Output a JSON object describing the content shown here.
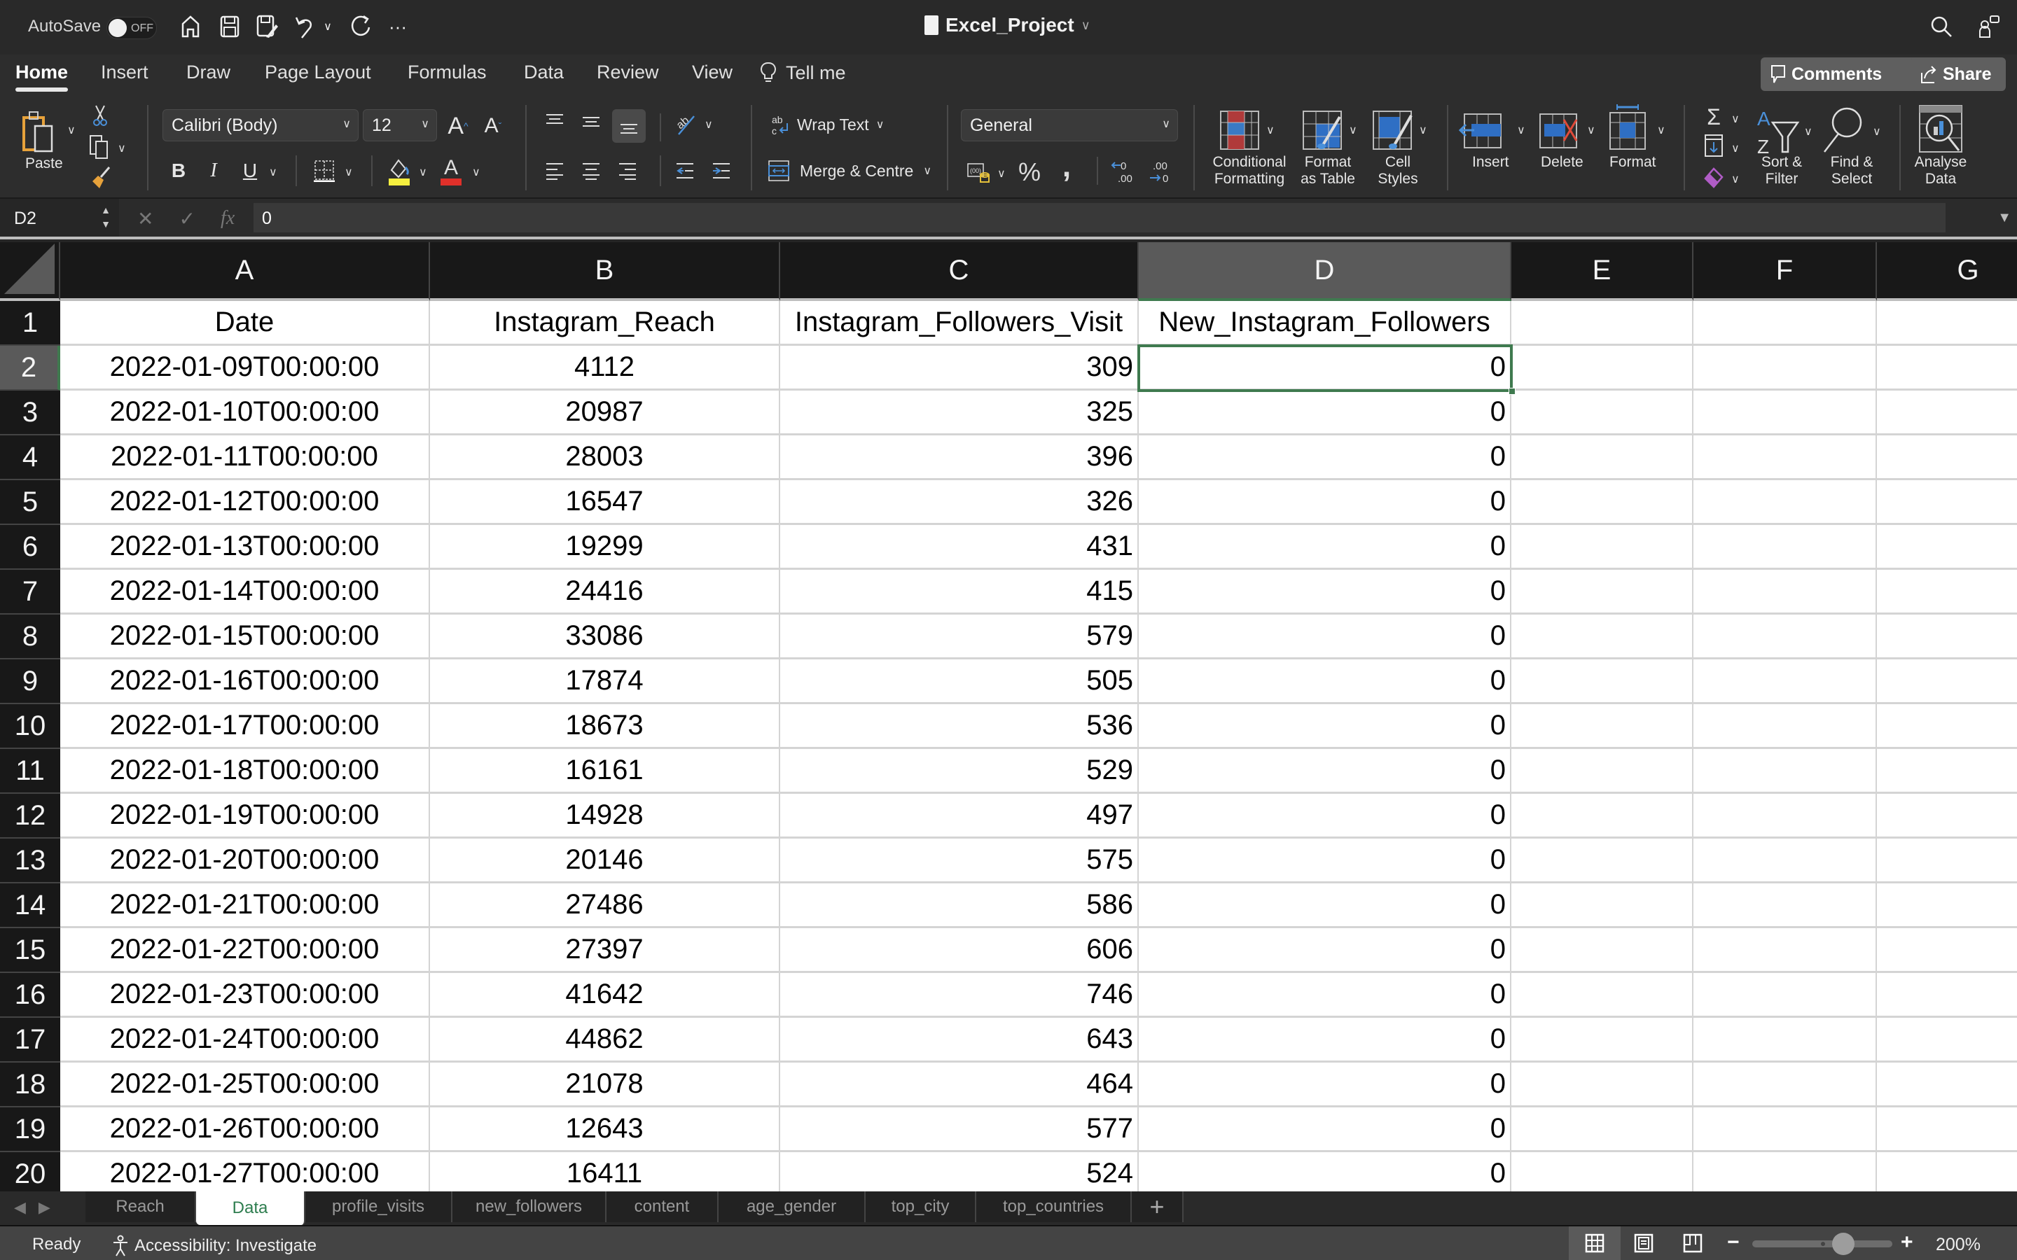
{
  "titlebar": {
    "autosave_label": "AutoSave",
    "autosave_state": "OFF",
    "document_title": "Excel_Project",
    "quick_access": [
      "home-icon",
      "save-icon",
      "save-as-icon",
      "undo-icon",
      "redo-icon",
      "more-icon"
    ]
  },
  "ribbon_tabs": [
    {
      "label": "Home",
      "active": true
    },
    {
      "label": "Insert"
    },
    {
      "label": "Draw"
    },
    {
      "label": "Page Layout"
    },
    {
      "label": "Formulas"
    },
    {
      "label": "Data"
    },
    {
      "label": "Review"
    },
    {
      "label": "View"
    }
  ],
  "tell_me": "Tell me",
  "top_buttons": {
    "comments": "Comments",
    "share": "Share"
  },
  "ribbon": {
    "paste": "Paste",
    "font_name": "Calibri (Body)",
    "font_size": "12",
    "bold": "B",
    "italic": "I",
    "underline": "U",
    "wrap_text": "Wrap Text",
    "merge_centre": "Merge & Centre",
    "number_format": "General",
    "percent": "%",
    "comma": ",",
    "conditional_formatting": [
      "Conditional",
      "Formatting"
    ],
    "format_as_table": [
      "Format",
      "as Table"
    ],
    "cell_styles": [
      "Cell",
      "Styles"
    ],
    "insert": "Insert",
    "delete": "Delete",
    "format": "Format",
    "sort_filter": [
      "Sort &",
      "Filter"
    ],
    "find_select": [
      "Find &",
      "Select"
    ],
    "analyse_data": [
      "Analyse",
      "Data"
    ],
    "colors": {
      "fill": "#f5ef3f",
      "font": "#e0302a",
      "accent_blue": "#4a90d9",
      "accent_red": "#c0392b"
    }
  },
  "formula_bar": {
    "name_box": "D2",
    "formula": "0"
  },
  "sheet": {
    "columns": [
      "A",
      "B",
      "C",
      "D",
      "E",
      "F",
      "G"
    ],
    "selected_column": "D",
    "selected_row": 2,
    "selected_cell": "D2",
    "header_row": [
      "Date",
      "Instagram_Reach",
      "Instagram_Followers_Visit",
      "New_Instagram_Followers"
    ],
    "rows": [
      [
        "2022-01-09T00:00:00",
        "4112",
        "309",
        "0"
      ],
      [
        "2022-01-10T00:00:00",
        "20987",
        "325",
        "0"
      ],
      [
        "2022-01-11T00:00:00",
        "28003",
        "396",
        "0"
      ],
      [
        "2022-01-12T00:00:00",
        "16547",
        "326",
        "0"
      ],
      [
        "2022-01-13T00:00:00",
        "19299",
        "431",
        "0"
      ],
      [
        "2022-01-14T00:00:00",
        "24416",
        "415",
        "0"
      ],
      [
        "2022-01-15T00:00:00",
        "33086",
        "579",
        "0"
      ],
      [
        "2022-01-16T00:00:00",
        "17874",
        "505",
        "0"
      ],
      [
        "2022-01-17T00:00:00",
        "18673",
        "536",
        "0"
      ],
      [
        "2022-01-18T00:00:00",
        "16161",
        "529",
        "0"
      ],
      [
        "2022-01-19T00:00:00",
        "14928",
        "497",
        "0"
      ],
      [
        "2022-01-20T00:00:00",
        "20146",
        "575",
        "0"
      ],
      [
        "2022-01-21T00:00:00",
        "27486",
        "586",
        "0"
      ],
      [
        "2022-01-22T00:00:00",
        "27397",
        "606",
        "0"
      ],
      [
        "2022-01-23T00:00:00",
        "41642",
        "746",
        "0"
      ],
      [
        "2022-01-24T00:00:00",
        "44862",
        "643",
        "0"
      ],
      [
        "2022-01-25T00:00:00",
        "21078",
        "464",
        "0"
      ],
      [
        "2022-01-26T00:00:00",
        "12643",
        "577",
        "0"
      ],
      [
        "2022-01-27T00:00:00",
        "16411",
        "524",
        "0"
      ]
    ]
  },
  "sheet_tabs": [
    {
      "label": "Reach"
    },
    {
      "label": "Data",
      "active": true
    },
    {
      "label": "profile_visits"
    },
    {
      "label": "new_followers"
    },
    {
      "label": "content"
    },
    {
      "label": "age_gender"
    },
    {
      "label": "top_city"
    },
    {
      "label": "top_countries"
    }
  ],
  "status": {
    "ready": "Ready",
    "accessibility": "Accessibility: Investigate",
    "zoom": "200%",
    "zoom_slider_fraction": 0.65
  }
}
